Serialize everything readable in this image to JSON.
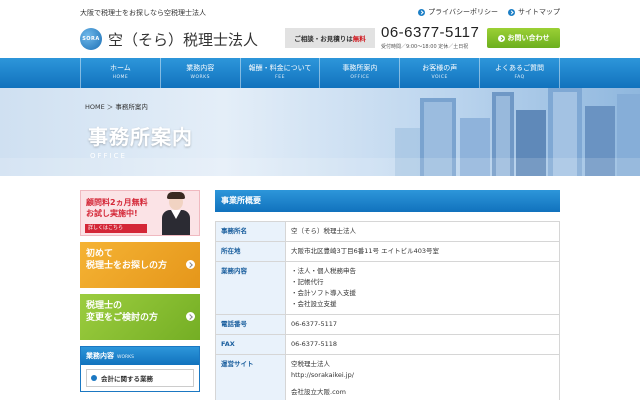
{
  "header": {
    "tagline": "大阪で税理士をお探しなら空税理士法人",
    "links": [
      "プライバシーポリシー",
      "サイトマップ"
    ],
    "logo_mark": "SORA",
    "logo_text": "空（そら）税理士法人",
    "consult_text": "ご相談・お見積りは",
    "consult_free": "無料",
    "phone": "06-6377-5117",
    "hours": "受付時間／9:00〜18:00 定休／土日祝",
    "contact_button": "お問い合わせ"
  },
  "nav": [
    {
      "jp": "ホーム",
      "en": "HOME"
    },
    {
      "jp": "業務内容",
      "en": "WORKS"
    },
    {
      "jp": "報酬・料金について",
      "en": "FEE"
    },
    {
      "jp": "事務所案内",
      "en": "OFFICE"
    },
    {
      "jp": "お客様の声",
      "en": "VOICE"
    },
    {
      "jp": "よくあるご質問",
      "en": "FAQ"
    }
  ],
  "hero": {
    "breadcrumb": "HOME ＞ 事務所案内",
    "title": "事務所案内",
    "subtitle": "OFFICE"
  },
  "sidebar": {
    "banner1": {
      "line1": "顧問料2ヵ月無料",
      "line2": "お試し実施中!",
      "more": "詳しくはこちら"
    },
    "banner2": {
      "line1": "初めて",
      "line2": "税理士をお探しの方"
    },
    "banner3": {
      "line1": "税理士の",
      "line2": "変更をご検討の方"
    },
    "menu_title": "業務内容",
    "menu_title_en": "WORKS",
    "menu_items": [
      "会計に関する業務"
    ]
  },
  "content": {
    "section_title": "事業所概要",
    "rows": [
      {
        "label": "事務所名",
        "value": [
          "空（そら）税理士法人"
        ]
      },
      {
        "label": "所在地",
        "value": [
          "大阪市北区豊崎3丁目6番11号 エイトビル403号室"
        ]
      },
      {
        "label": "業務内容",
        "value": [
          "・法人・個人税務申告",
          "・記帳代行",
          "・会計ソフト導入支援",
          "・会社設立支援"
        ]
      },
      {
        "label": "電話番号",
        "value": [
          "06-6377-5117"
        ]
      },
      {
        "label": "FAX",
        "value": [
          "06-6377-5118"
        ]
      },
      {
        "label": "運営サイト",
        "value": [
          "空税理士法人",
          "http://sorakaikei.jp/",
          "",
          "会社設立大阪.com"
        ]
      }
    ]
  },
  "colors": {
    "primary_blue": "#1b78c2",
    "accent_green": "#7cbd24",
    "accent_red": "#d42737",
    "accent_orange": "#f0a62a"
  }
}
